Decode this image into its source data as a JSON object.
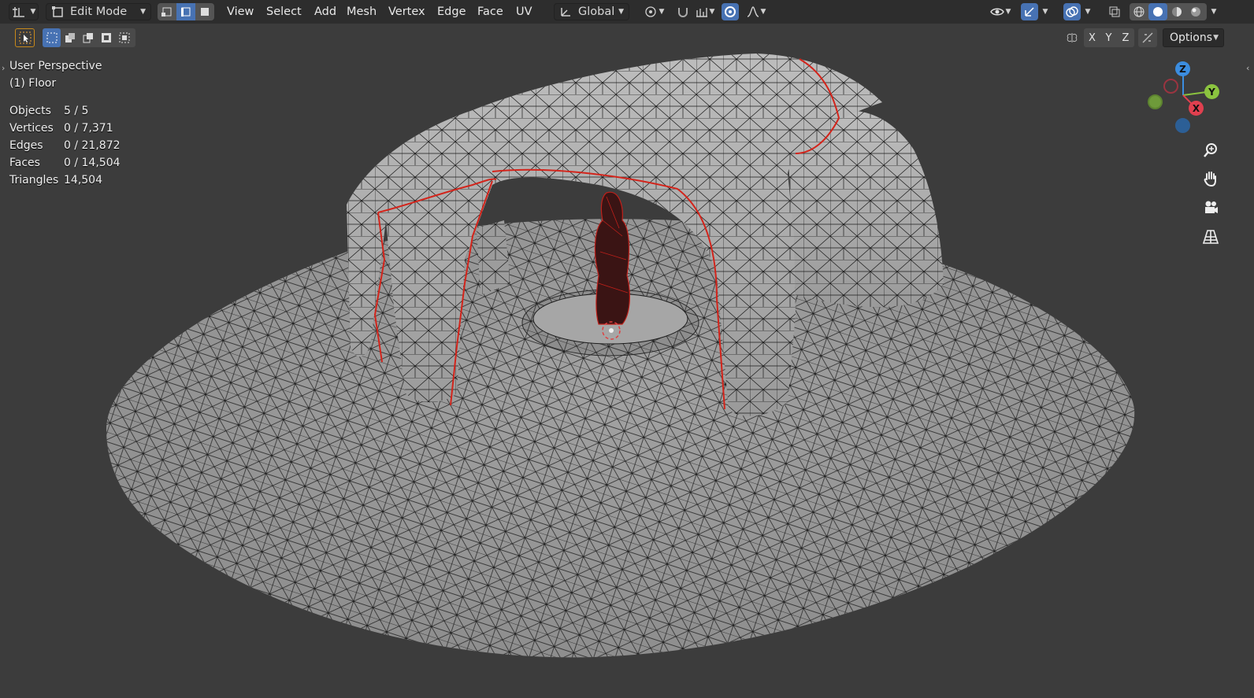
{
  "header": {
    "mode_label": "Edit Mode",
    "menus": [
      "View",
      "Select",
      "Add",
      "Mesh",
      "Vertex",
      "Edge",
      "Face",
      "UV"
    ],
    "transform_orientation": "Global",
    "options_label": "Options",
    "axis_x": "X",
    "axis_y": "Y",
    "axis_z": "Z"
  },
  "viewport": {
    "view_name": "User Perspective",
    "active_object": "(1) Floor",
    "stats": [
      {
        "label": "Objects",
        "value": "5 / 5"
      },
      {
        "label": "Vertices",
        "value": "0 / 7,371"
      },
      {
        "label": "Edges",
        "value": "0 / 21,872"
      },
      {
        "label": "Faces",
        "value": "0 / 14,504"
      },
      {
        "label": "Triangles",
        "value": "14,504"
      }
    ]
  },
  "gizmo": {
    "z": "Z",
    "y": "Y",
    "x": "X"
  },
  "colors": {
    "accent": "#4772b3",
    "seam": "#d3241b",
    "gizmo_x": "#e0404f",
    "gizmo_y": "#8bc43f",
    "gizmo_z": "#3b8de0"
  }
}
